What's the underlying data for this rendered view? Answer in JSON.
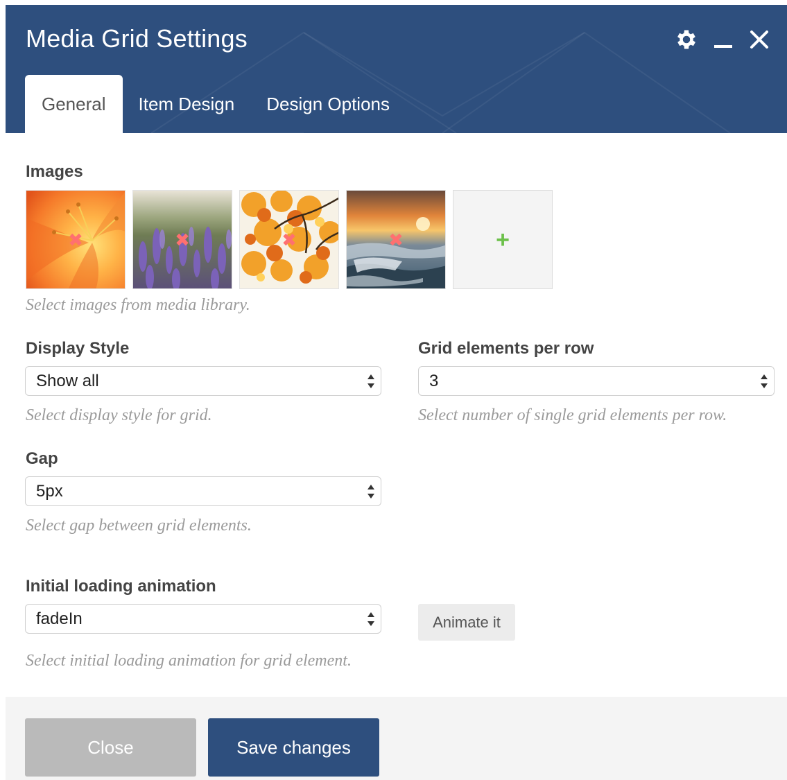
{
  "window": {
    "title": "Media Grid Settings"
  },
  "header_icons": [
    "gear-icon",
    "minimize-icon",
    "close-icon"
  ],
  "tabs": [
    {
      "label": "General",
      "active": true
    },
    {
      "label": "Item Design",
      "active": false
    },
    {
      "label": "Design Options",
      "active": false
    }
  ],
  "images_section": {
    "label": "Images",
    "items": [
      {
        "name": "orange-lily-image",
        "remove_icon": "✖"
      },
      {
        "name": "lavender-field-image",
        "remove_icon": "✖"
      },
      {
        "name": "autumn-leaves-image",
        "remove_icon": "✖"
      },
      {
        "name": "seashore-sunset-image",
        "remove_icon": "✖"
      }
    ],
    "add_symbol": "+",
    "hint": "Select images from media library."
  },
  "display_style": {
    "label": "Display Style",
    "value": "Show all",
    "hint": "Select display style for grid."
  },
  "grid_elements": {
    "label": "Grid elements per row",
    "value": "3",
    "hint": "Select number of single grid elements per row."
  },
  "gap": {
    "label": "Gap",
    "value": "5px",
    "hint": "Select gap between grid elements."
  },
  "animation": {
    "label": "Initial loading animation",
    "value": "fadeIn",
    "button_label": "Animate it",
    "hint": "Select initial loading animation for grid element."
  },
  "footer": {
    "close_label": "Close",
    "save_label": "Save changes"
  },
  "colors": {
    "header_bg": "#2e4f7e",
    "save_button": "#2e4f7e",
    "close_button": "#bababa",
    "add_plus": "#6cc04a",
    "remove_x": "#ff7070"
  }
}
